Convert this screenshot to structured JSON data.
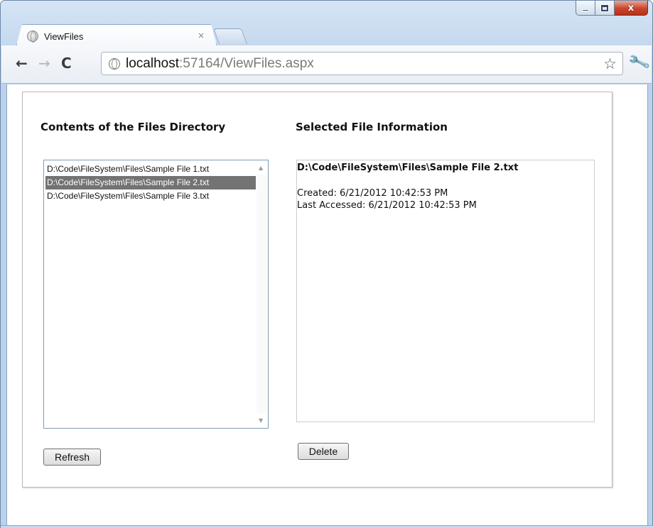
{
  "browser": {
    "tab": {
      "title": "ViewFiles",
      "close_glyph": "×"
    },
    "window_controls": {
      "minimize_icon": "minimize-icon",
      "maximize_icon": "maximize-icon",
      "close_glyph": "x"
    },
    "nav": {
      "back_glyph": "←",
      "forward_glyph": "→",
      "reload_glyph": "C"
    },
    "address": {
      "host": "localhost",
      "rest": ":57164/ViewFiles.aspx"
    },
    "bookmark_glyph": "☆",
    "wrench_glyph": "🔧"
  },
  "page": {
    "left_heading": "Contents of the Files Directory",
    "right_heading": "Selected File Information",
    "files": [
      {
        "path": "D:\\Code\\FileSystem\\Files\\Sample File 1.txt",
        "selected": false
      },
      {
        "path": "D:\\Code\\FileSystem\\Files\\Sample File 2.txt",
        "selected": true
      },
      {
        "path": "D:\\Code\\FileSystem\\Files\\Sample File 3.txt",
        "selected": false
      }
    ],
    "info": {
      "path": "D:\\Code\\FileSystem\\Files\\Sample File 2.txt",
      "created": "Created: 6/21/2012 10:42:53 PM",
      "accessed": "Last Accessed: 6/21/2012 10:42:53 PM"
    },
    "refresh_label": "Refresh",
    "delete_label": "Delete"
  },
  "colors": {
    "selection": "#737373",
    "frame": "#c5d9ef"
  }
}
